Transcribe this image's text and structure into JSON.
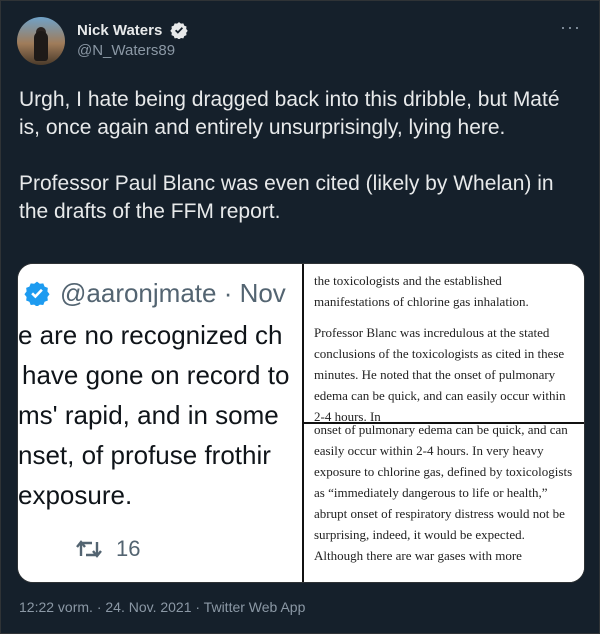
{
  "author": {
    "display_name": "Nick Waters",
    "handle": "@N_Waters89"
  },
  "more_label": "···",
  "tweet": {
    "text": "Urgh, I hate being dragged back into this dribble, but Maté is, once again and entirely unsurprisingly, lying here.\n\nProfessor Paul Blanc was even cited (likely by Whelan) in the drafts of the FFM report."
  },
  "media": {
    "left": {
      "handle_line": "@aaronjmate · Nov",
      "lines": [
        "e are no recognized ch",
        "have gone on record to",
        "ms' rapid, and in some",
        "nset, of profuse frothir",
        "exposure."
      ],
      "retweet_count": "16"
    },
    "right_top": {
      "para1": "the toxicologists and the established manifestations of chlorine gas inhalation.",
      "para2": "Professor Blanc was incredulous at the stated conclusions of the toxicologists as cited in these minutes. He noted that the onset of pulmonary edema can be quick, and can easily occur within 2-4 hours. In"
    },
    "right_bottom": {
      "text": "onset of pulmonary edema can be quick, and can easily occur within 2-4 hours. In very heavy exposure to chlorine gas, defined by toxicologists as “immediately dangerous to life or health,” abrupt onset of respiratory distress would not be surprising, indeed, it would be expected. Although there are war gases with more"
    }
  },
  "timestamp": "12:22 vorm. · 24. Nov. 2021 · Twitter Web App",
  "colors": {
    "background": "#15202b",
    "text": "#e7e9ea",
    "muted": "#8b98a5",
    "verified": "#1d9bf0"
  }
}
